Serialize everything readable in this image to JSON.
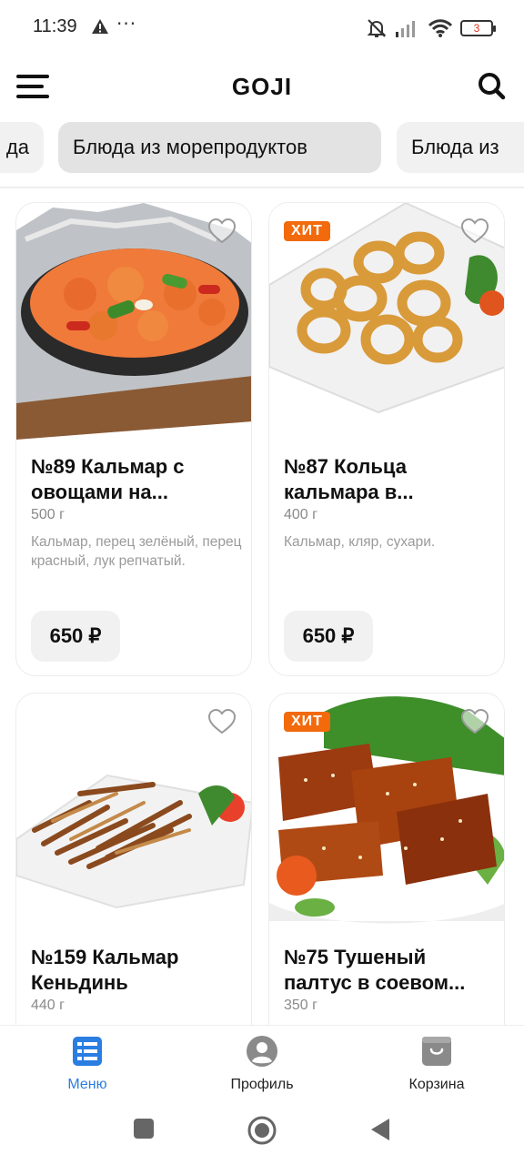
{
  "status_bar": {
    "time": "11:39",
    "dots": "···",
    "battery": "3",
    "icons": [
      "warning-icon",
      "muted-bell-icon",
      "signal-icon",
      "wifi-icon",
      "battery-icon"
    ]
  },
  "header": {
    "title": "GOJI",
    "icons": [
      "hamburger-menu-icon",
      "search-icon"
    ]
  },
  "categories": {
    "items": [
      "да",
      "Блюда из морепродуктов",
      "Блюда из"
    ],
    "active_index": 1
  },
  "products": [
    {
      "title": "№89 Кальмар с овощами на...",
      "weight": "500 г",
      "description": "Кальмар, перец зелёный, перец красный, лук репчатый.",
      "price": "650 ₽",
      "badge": "",
      "favorite": false
    },
    {
      "title": "№87 Кольца кальмара в...",
      "weight": "400 г",
      "description": "Кальмар, кляр, сухари.",
      "price": "650 ₽",
      "badge": "ХИТ",
      "favorite": false
    },
    {
      "title": "№159 Кальмар Кеньдинь",
      "weight": "440 г",
      "description": "",
      "price": "",
      "badge": "",
      "favorite": false
    },
    {
      "title": "№75 Тушеный палтус в соевом...",
      "weight": "350 г",
      "description": "",
      "price": "",
      "badge": "ХИТ",
      "favorite": false
    }
  ],
  "bottom_nav": {
    "items": [
      {
        "label": "Меню",
        "icon": "menu-list-icon",
        "active": true
      },
      {
        "label": "Профиль",
        "icon": "profile-icon",
        "active": false
      },
      {
        "label": "Корзина",
        "icon": "cart-bag-icon",
        "active": false
      }
    ]
  },
  "colors": {
    "accent": "#2a7de1",
    "badge": "#f26a0c",
    "chip_bg": "#f1f1f1"
  }
}
